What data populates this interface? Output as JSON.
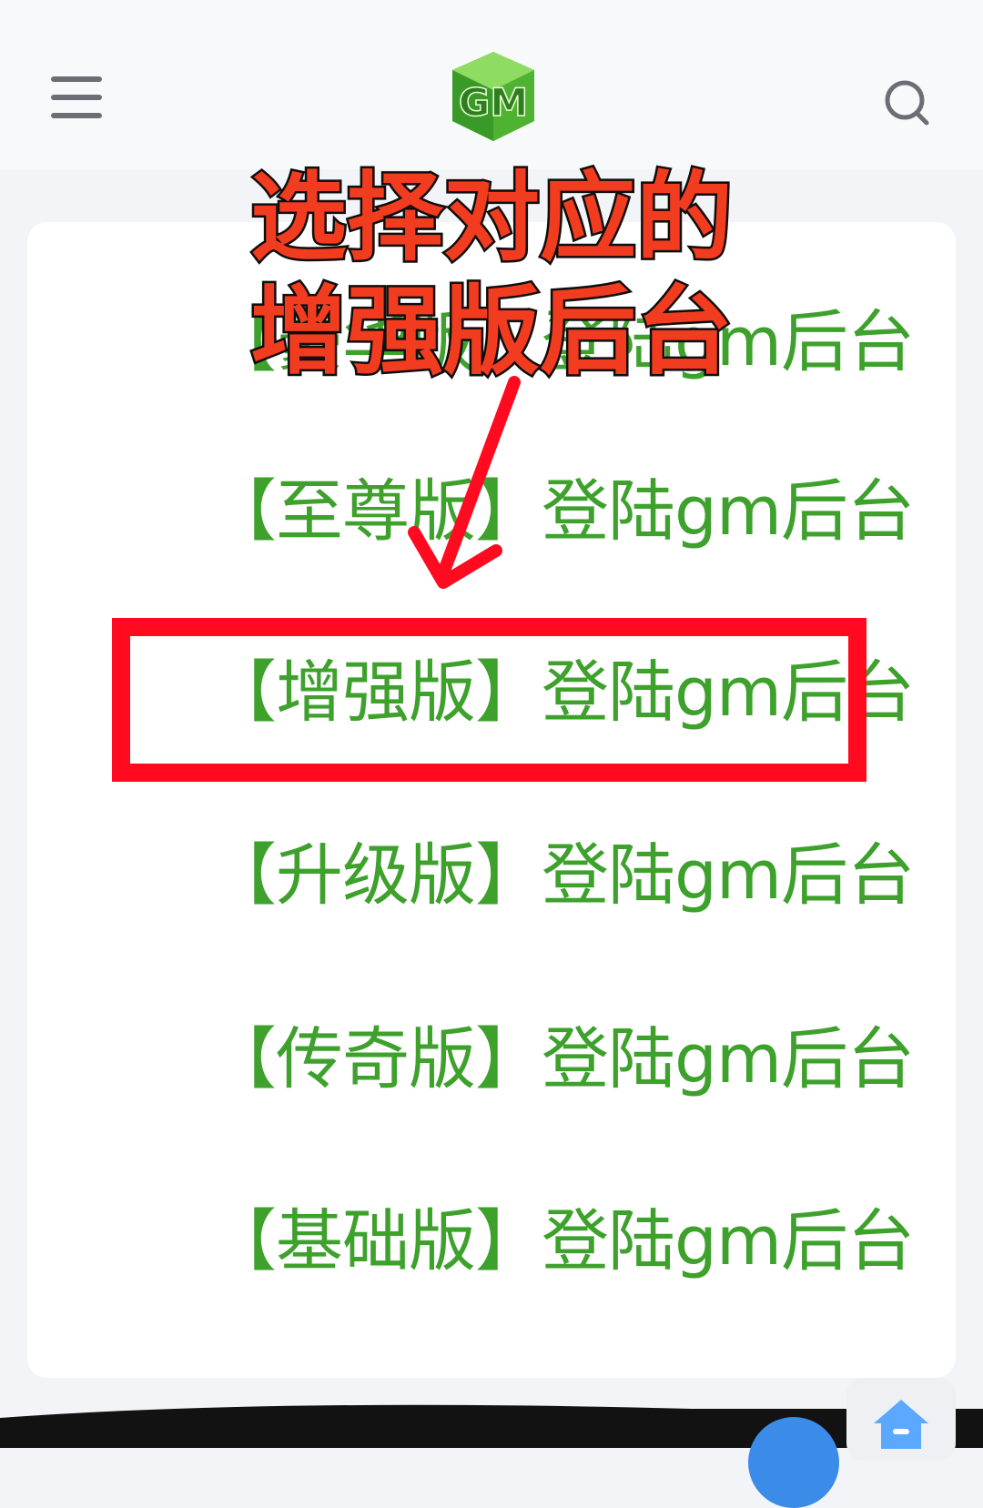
{
  "header": {
    "logo_text": "GM"
  },
  "links": [
    {
      "label": "【豪华版】登陆gm后台"
    },
    {
      "label": "【至尊版】登陆gm后台"
    },
    {
      "label": "【增强版】登陆gm后台"
    },
    {
      "label": "【升级版】登陆gm后台"
    },
    {
      "label": "【传奇版】登陆gm后台"
    },
    {
      "label": "【基础版】登陆gm后台"
    }
  ],
  "annotation": {
    "line1": "选择对应的",
    "line2": "增强版后台"
  },
  "colors": {
    "link_green": "#3da12c",
    "highlight_red": "#ff0a1e",
    "overlay_text": "#f23c1f"
  },
  "icons": {
    "menu": "menu-icon",
    "search": "search-icon",
    "home": "home-icon",
    "logo": "gm-logo"
  }
}
